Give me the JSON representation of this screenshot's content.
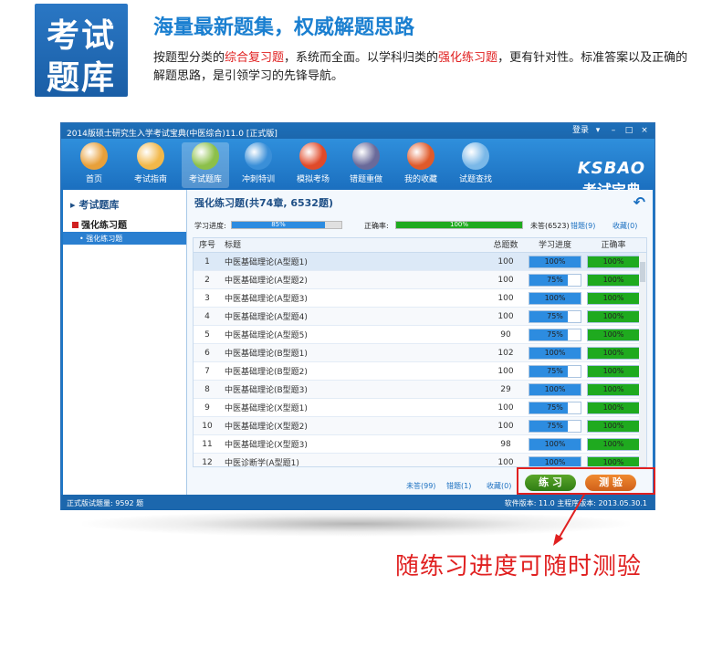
{
  "promo": {
    "badge_line1": "考试",
    "badge_line2": "题库",
    "headline": "海量最新题集，权威解题思路",
    "desc_part1": "按题型分类的",
    "desc_hl1": "综合复习题",
    "desc_part2": "，系统而全面。以学科归类的",
    "desc_hl2": "强化练习题",
    "desc_part3": "，更有针对性。标准答案以及正确的解题思路，是引领学习的先锋导航。",
    "caption": "随练习进度可随时测验"
  },
  "window": {
    "title": "2014版硕士研究生入学考试宝典(中医综合)11.0 [正式版]",
    "controls": [
      "登录",
      "▾",
      "–",
      "□",
      "×"
    ],
    "logo_en": "KSBAO",
    "logo_cn": "考试宝典"
  },
  "toolbar": [
    {
      "label": "首页",
      "icon": "home-icon",
      "color": "#e8a03a"
    },
    {
      "label": "考试指南",
      "icon": "compass-icon",
      "color": "#f2b84a"
    },
    {
      "label": "考试题库",
      "icon": "books-icon",
      "color": "#8cc04a"
    },
    {
      "label": "冲刺特训",
      "icon": "globe-icon",
      "color": "#3a8fd8"
    },
    {
      "label": "模拟考场",
      "icon": "clock-icon",
      "color": "#e04a2a"
    },
    {
      "label": "错题重做",
      "icon": "pen-icon",
      "color": "#6a6a9a"
    },
    {
      "label": "我的收藏",
      "icon": "star-icon",
      "color": "#e05a2a"
    },
    {
      "label": "试题查找",
      "icon": "search-icon",
      "color": "#7ab8e8"
    }
  ],
  "sidebar": {
    "section": "▸ 考试题库",
    "group": "强化练习题",
    "item": "• 强化练习题"
  },
  "main": {
    "title": "强化练习题(共74章, 6532题)",
    "progress_label": "学习进度:",
    "progress_value": "85%",
    "progress_fraction": 0.85,
    "accuracy_label": "正确率:",
    "accuracy_value": "100%",
    "accuracy_fraction": 1.0,
    "unanswered": "未答(6523)",
    "wrong": "错题(9)",
    "favorites": "收藏(0)",
    "columns": [
      "序号",
      "标题",
      "总题数",
      "学习进度",
      "正确率"
    ],
    "rows": [
      {
        "no": "1",
        "title": "中医基础理论(A型题1)",
        "total": "100",
        "progress": "100%",
        "pfrac": 1.0,
        "acc": "100%"
      },
      {
        "no": "2",
        "title": "中医基础理论(A型题2)",
        "total": "100",
        "progress": "75%",
        "pfrac": 0.75,
        "acc": "100%"
      },
      {
        "no": "3",
        "title": "中医基础理论(A型题3)",
        "total": "100",
        "progress": "100%",
        "pfrac": 1.0,
        "acc": "100%"
      },
      {
        "no": "4",
        "title": "中医基础理论(A型题4)",
        "total": "100",
        "progress": "75%",
        "pfrac": 0.75,
        "acc": "100%"
      },
      {
        "no": "5",
        "title": "中医基础理论(A型题5)",
        "total": "90",
        "progress": "75%",
        "pfrac": 0.75,
        "acc": "100%"
      },
      {
        "no": "6",
        "title": "中医基础理论(B型题1)",
        "total": "102",
        "progress": "100%",
        "pfrac": 1.0,
        "acc": "100%"
      },
      {
        "no": "7",
        "title": "中医基础理论(B型题2)",
        "total": "100",
        "progress": "75%",
        "pfrac": 0.75,
        "acc": "100%"
      },
      {
        "no": "8",
        "title": "中医基础理论(B型题3)",
        "total": "29",
        "progress": "100%",
        "pfrac": 1.0,
        "acc": "100%"
      },
      {
        "no": "9",
        "title": "中医基础理论(X型题1)",
        "total": "100",
        "progress": "75%",
        "pfrac": 0.75,
        "acc": "100%"
      },
      {
        "no": "10",
        "title": "中医基础理论(X型题2)",
        "total": "100",
        "progress": "75%",
        "pfrac": 0.75,
        "acc": "100%"
      },
      {
        "no": "11",
        "title": "中医基础理论(X型题3)",
        "total": "98",
        "progress": "100%",
        "pfrac": 1.0,
        "acc": "100%"
      },
      {
        "no": "12",
        "title": "中医诊断学(A型题1)",
        "total": "100",
        "progress": "100%",
        "pfrac": 1.0,
        "acc": "100%"
      }
    ],
    "footer_unanswered": "未答(99)",
    "footer_wrong": "错题(1)",
    "footer_fav": "收藏(0)",
    "practice_button": "练 习",
    "test_button": "测 验"
  },
  "status": {
    "left": "正式版试题量: 9592 题",
    "right": "软件版本: 11.0 主程序版本: 2013.05.30.1"
  },
  "colors": {
    "progress_blue": "#2d8ce0",
    "accuracy_green": "#1faa1f",
    "highlight_red": "#e02020"
  }
}
